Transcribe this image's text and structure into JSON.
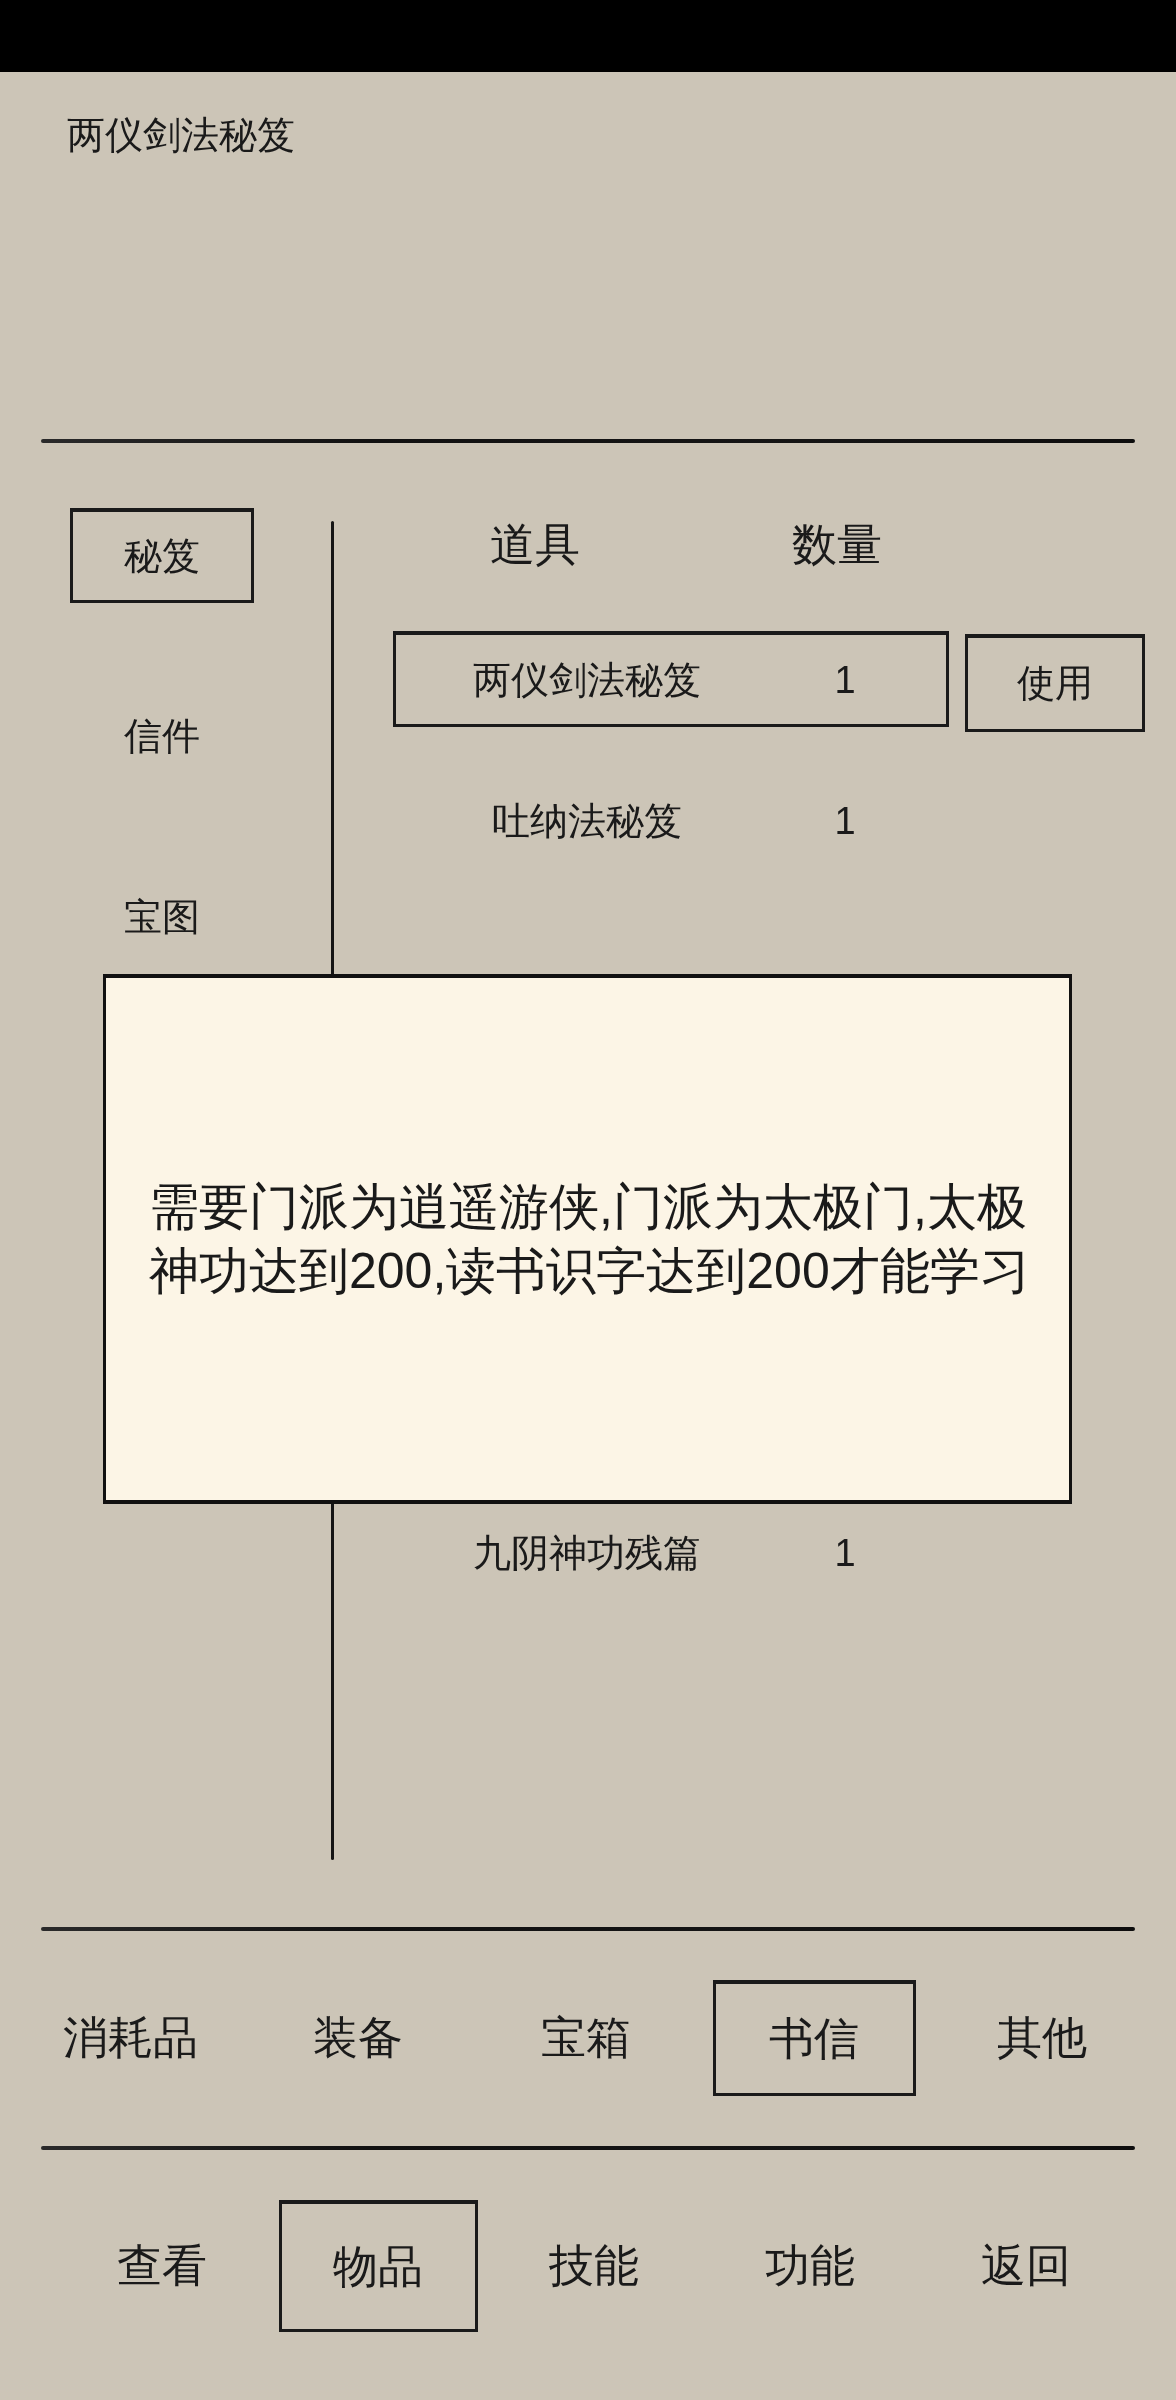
{
  "title": "两仪剑法秘笈",
  "sidebar": {
    "items": [
      {
        "label": "秘笈",
        "selected": true
      },
      {
        "label": "信件",
        "selected": false
      },
      {
        "label": "宝图",
        "selected": false
      }
    ]
  },
  "list": {
    "columns": [
      "道具",
      "数量"
    ],
    "rows": [
      {
        "name": "两仪剑法秘笈",
        "quantity": "1",
        "selected": true
      },
      {
        "name": "吐纳法秘笈",
        "quantity": "1",
        "selected": false
      }
    ],
    "rows_after_popup": [
      {
        "name": "九阴神功残篇",
        "quantity": "1",
        "selected": false
      }
    ],
    "use_button": "使用"
  },
  "popup": {
    "message": "需要门派为逍遥游侠,门派为太极门,太极神功达到200,读书识字达到200才能学习"
  },
  "category_tabs": [
    {
      "label": "消耗品",
      "selected": false
    },
    {
      "label": "装备",
      "selected": false
    },
    {
      "label": "宝箱",
      "selected": false
    },
    {
      "label": "书信",
      "selected": true
    },
    {
      "label": "其他",
      "selected": false
    }
  ],
  "nav_tabs": [
    {
      "label": "查看",
      "selected": false
    },
    {
      "label": "物品",
      "selected": true
    },
    {
      "label": "技能",
      "selected": false
    },
    {
      "label": "功能",
      "selected": false
    },
    {
      "label": "返回",
      "selected": false
    }
  ]
}
